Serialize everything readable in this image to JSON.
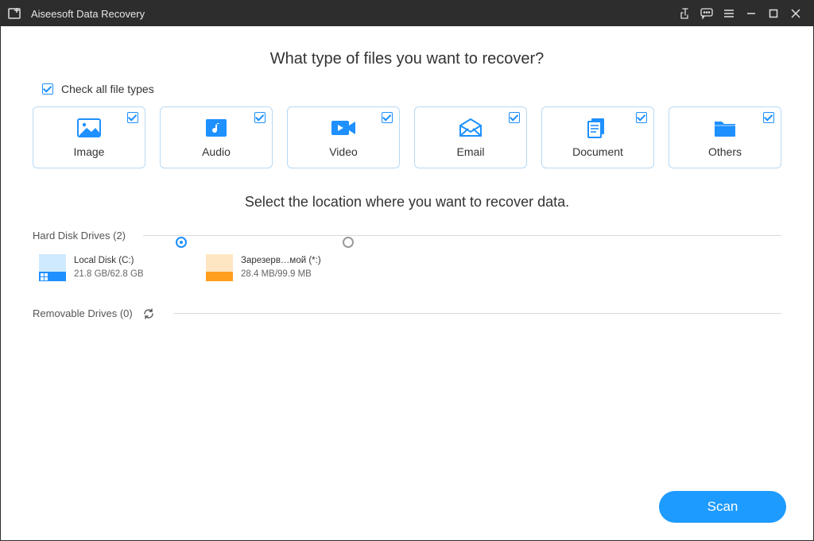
{
  "app": {
    "title": "Aiseesoft Data Recovery"
  },
  "heading": "What type of files you want to recover?",
  "check_all_label": "Check all file types",
  "file_types": [
    {
      "key": "image",
      "label": "Image"
    },
    {
      "key": "audio",
      "label": "Audio"
    },
    {
      "key": "video",
      "label": "Video"
    },
    {
      "key": "email",
      "label": "Email"
    },
    {
      "key": "document",
      "label": "Document"
    },
    {
      "key": "others",
      "label": "Others"
    }
  ],
  "location_heading": "Select the location where you want to recover data.",
  "hard_disk_section_label": "Hard Disk Drives (2)",
  "removable_section_label": "Removable Drives (0)",
  "drives": [
    {
      "name": "Local Disk (C:)",
      "size": "21.8 GB/62.8 GB",
      "selected": true,
      "color": "blue"
    },
    {
      "name": "Зарезерв…мой (*:)",
      "size": "28.4 MB/99.9 MB",
      "selected": false,
      "color": "orange"
    }
  ],
  "scan_button_label": "Scan"
}
